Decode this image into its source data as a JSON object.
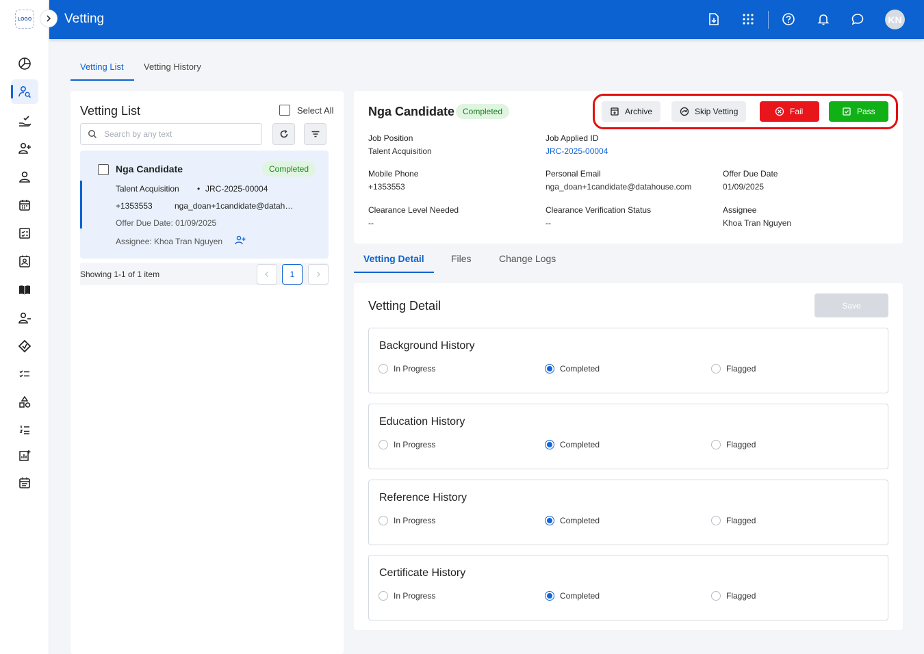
{
  "app": {
    "logo_text": "LOGO",
    "page_title": "Vetting",
    "user_initials": "KN"
  },
  "main_tabs": [
    {
      "label": "Vetting List"
    },
    {
      "label": "Vetting History"
    }
  ],
  "list": {
    "title": "Vetting List",
    "select_all": "Select All",
    "search_placeholder": "Search by any text",
    "card": {
      "name": "Nga Candidate",
      "status": "Completed",
      "position": "Talent Acquisition",
      "job_id": "JRC-2025-00004",
      "phone": "+1353553",
      "email": "nga_doan+1candidate@datah…",
      "offer_due": "Offer Due Date: 01/09/2025",
      "assignee": "Assignee: Khoa Tran Nguyen"
    },
    "showing": "Showing 1-1 of 1 item",
    "page": "1"
  },
  "detail": {
    "name": "Nga Candidate",
    "status": "Completed",
    "actions": {
      "archive": "Archive",
      "skip": "Skip Vetting",
      "fail": "Fail",
      "pass": "Pass"
    },
    "fields": {
      "job_position_label": "Job Position",
      "job_position": "Talent Acquisition",
      "job_id_label": "Job Applied ID",
      "job_id": "JRC-2025-00004",
      "phone_label": "Mobile Phone",
      "phone": "+1353553",
      "email_label": "Personal Email",
      "email": "nga_doan+1candidate@datahouse.com",
      "offer_label": "Offer Due Date",
      "offer": "01/09/2025",
      "clearance_label": "Clearance Level Needed",
      "clearance": "--",
      "verification_label": "Clearance Verification Status",
      "verification": "--",
      "assignee_label": "Assignee",
      "assignee": "Khoa Tran Nguyen"
    }
  },
  "sub_tabs": [
    {
      "label": "Vetting Detail"
    },
    {
      "label": "Files"
    },
    {
      "label": "Change Logs"
    }
  ],
  "vetting_detail": {
    "title": "Vetting Detail",
    "save": "Save",
    "options": {
      "in_progress": "In Progress",
      "completed": "Completed",
      "flagged": "Flagged"
    },
    "sections": [
      {
        "title": "Background History",
        "selected": "Completed"
      },
      {
        "title": "Education History",
        "selected": "Completed"
      },
      {
        "title": "Reference History",
        "selected": "Completed"
      },
      {
        "title": "Certificate History",
        "selected": "Completed"
      }
    ]
  },
  "colors": {
    "primary": "#0b62d0",
    "fail": "#e8151b",
    "pass": "#10b117",
    "highlight": "#e01010"
  }
}
